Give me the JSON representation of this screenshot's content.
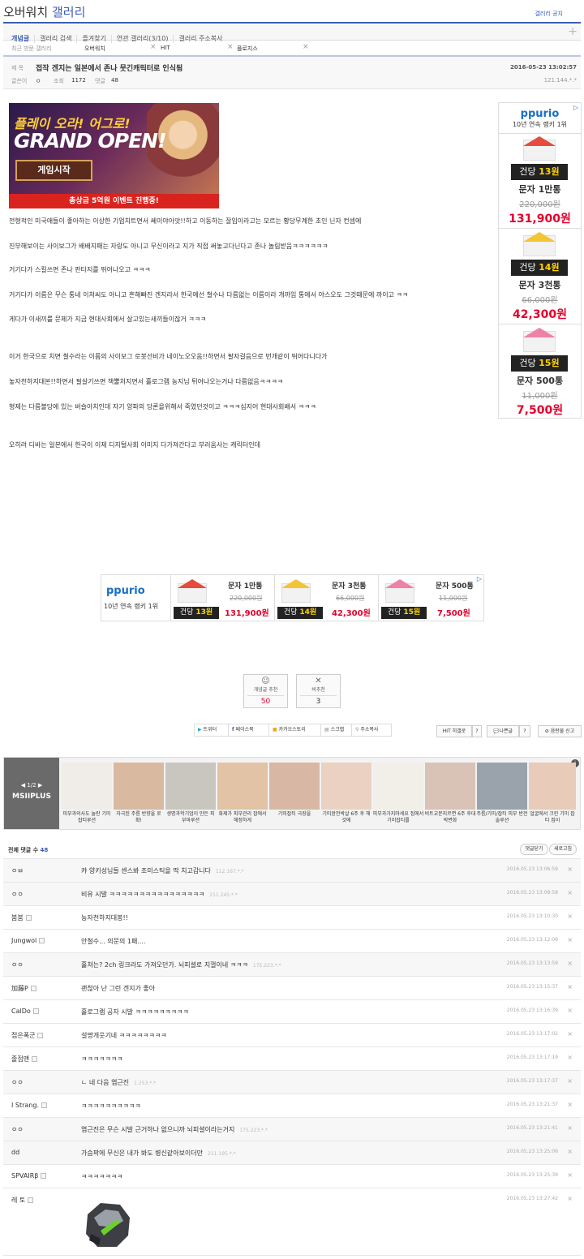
{
  "header": {
    "title_prefix": "오버워치",
    "title_suffix": "갤러리",
    "top_right": "갤러리 공지"
  },
  "tabs": [
    "개념글",
    "갤러리 검색",
    "즐겨찾기",
    "연관 갤러리(3/10)",
    "갤러리 주소복사"
  ],
  "plus": "+",
  "recent": {
    "label": "최근 방문 갤러리",
    "items": [
      "오버워치",
      "HIT",
      "플로지스"
    ]
  },
  "post": {
    "title_label": "제 목",
    "title": "접작 겐지는 일본에서 존나 뭇긴캐릭터로 인식됨",
    "date": "2016-05-23 13:02:57",
    "author_label": "글쓴이",
    "author": "ㅇ",
    "views_label": "조회",
    "views": "1172",
    "comments_label": "댓글",
    "comments": "48",
    "ip": "121.144.*.*",
    "body": [
      "전형적인 미국애들이 좋아하는 이상한 기업치트면서 쎄이야아앗!!하고 이동하는 잘입이라고는 모르는 황당무계한 초인 닌자 컨셉에",
      "진부해보이는 사이보그가 배배지패는 자랑도 아니고 무신이라고 지가 직접 써놓고다닌다고 존나 놀림받음ㅋㅋㅋㅋㅋㅋ",
      "거기다가 스킬쓰면 존나 판타지를 뛰어나오고 ㅋㅋㅋ",
      "거기다가 이름은 무슨 통네 이쳐씨도 아니고 흔해빠진 겐지라서 한국에선 철수나 다름없는 이름이라 개까임 통에서 야스오도 그것때문에 까이고 ㅋㅋ",
      "게다가 이새끼를 문제가 지금 현대사회에서 살고있는새끼들이잖거 ㅋㅋㅋ",
      "이거 한국으로 치면 철수라는 이름의 사이보그 로봇선비가 네이노오오옴!!하면서 팔자걸음으로 번개같이 뛰어다니다가",
      "놓자천하지대본!!하면서 필살기쓰면 책뿔처지면서 홀로그램 농지님 튀어나오는거나 다름없음ㅋㅋㅋㅋ",
      "형제는 다름볼당에 있는 버슬아치인데 자기 양파의 당론을위해서 죽였던것이고 ㅋㅋㅋ심지어 현대사회배서 ㅋㅋㅋ",
      "오히려 디바는 일본에서 한국이 이제 디지털사회 이미지 다가져간다고 부러움사는 캐릭터인데"
    ]
  },
  "game_ad": {
    "line1": "플레이 오라! 어그로!",
    "line2": "GRAND OPEN!",
    "button": "게임시작",
    "bottom": "총상금 5억원 이벤트 진행중!"
  },
  "ppurio": {
    "brand": "ppurio",
    "tagline": "10년 연속 랭키 1위",
    "items": [
      {
        "price_prefix": "건당",
        "price": "13원",
        "name": "문자 1만통",
        "old": "220,000원",
        "new": "131,900원",
        "color": "#e44c3d"
      },
      {
        "price_prefix": "건당",
        "price": "14원",
        "name": "문자 3천통",
        "old": "66,000원",
        "new": "42,300원",
        "color": "#f3c533"
      },
      {
        "price_prefix": "건당",
        "price": "15원",
        "name": "문자 500통",
        "old": "11,000원",
        "new": "7,500원",
        "color": "#ee82a5"
      }
    ]
  },
  "votes": {
    "up_label": "개념글 추천",
    "up": "50",
    "down_label": "비추천",
    "down": "3"
  },
  "share": [
    "트위터",
    "페이스북",
    "카카오스토리",
    "스크랩",
    "주소복사"
  ],
  "actions": [
    "HIT 히갤로",
    "?",
    "나쁜글",
    "?",
    "음란물 신고"
  ],
  "ad_strip": {
    "pager": "1/2",
    "brand": "MSIIPLUS",
    "captions": [
      "피부과의사도 놀란 기미잡티루션",
      "자극된 주름 반향을 로 확!",
      "생명과학기업이 만든 피부마루션",
      "화제가 피부관리 잡에서 해정하게",
      "기미잡티 극장을",
      "기미완전박살 6주 후 해것에",
      "피부과가지마세요 집에서기미잡티를",
      "비트교문지르면 6주 후대박변화",
      "주름/기미/잡티 피부 반전솔루션",
      "얼굴에서 크린 기미 잡티 집이"
    ]
  },
  "comments_header": {
    "label": "전체 댓글 수",
    "count": "48",
    "fold": "댓글닫기",
    "refresh": "새로고침"
  },
  "comments": [
    {
      "nick": "ㅇㅂ",
      "text": "캬 양키성님들 센스봐 조미스틱을 딱 치고갑니다",
      "ip": "112.167.*.*",
      "date": "2016.05.23 13:06:59",
      "icon": false
    },
    {
      "nick": "ㅇㅇ",
      "text": "비유 시발 ㅋㅋㅋㅋㅋㅋㅋㅋㅋㅋㅋㅋㅋㅋㅋㅋ",
      "ip": "211.245.*.*",
      "date": "2016.05.23 13:08:58",
      "icon": false
    },
    {
      "nick": "붐붐",
      "text": "농자천하지대봉!!",
      "ip": "",
      "date": "2016.05.23 13:10:30",
      "icon": true
    },
    {
      "nick": "Jungwol",
      "text": "안철수... 의문의 1패....",
      "ip": "",
      "date": "2016.05.23 13:12:06",
      "icon": true
    },
    {
      "nick": "ㅇㅇ",
      "text": "홀쳐는? 2ch 링크라도 가져오던가. 뇌피셜로 지껄이네 ㅋㅋㅋ",
      "ip": "175.223.*.*",
      "date": "2016.05.23 13:13:59",
      "icon": false
    },
    {
      "nick": "加藤P",
      "text": "괜찮아 난 그런 겐지가 좋아",
      "ip": "",
      "date": "2016.05.23 13:15:37",
      "icon": true
    },
    {
      "nick": "CalDo",
      "text": "홀로그램 공자 시발 ㅋㅋㅋㅋㅋㅋㅋㅋㅋ",
      "ip": "",
      "date": "2016.05.23 13:16:39",
      "icon": true
    },
    {
      "nick": "접은폭군",
      "text": "설명개웃기네 ㅋㅋㅋㅋㅋㅋㅋㅋ",
      "ip": "",
      "date": "2016.05.23 13:17:02",
      "icon": true
    },
    {
      "nick": "졸접맨",
      "text": "ㅋㅋㅋㅋㅋㅋㅋ",
      "ip": "",
      "date": "2016.05.23 13:17:19",
      "icon": true
    },
    {
      "nick": "ㅇㅇ",
      "text": "ㄴ 네 다음 엽근진",
      "ip": "1.253.*.*",
      "date": "2016.05.23 13:17:37",
      "icon": false
    },
    {
      "nick": "I Strang.",
      "text": "ㅋㅋㅋㅋㅋㅋㅋㅋㅋㅋ",
      "ip": "",
      "date": "2016.05.23 13:21:37",
      "icon": true
    },
    {
      "nick": "ㅇㅇ",
      "text": "엽근진은 무슨 시발 근거하나 없으니까 뇌피셜이라는거지",
      "ip": "175.223.*.*",
      "date": "2016.05.23 13:21:41",
      "icon": false
    },
    {
      "nick": "dd",
      "text": "가슴팍에 무신은 내가 봐도 병신같아보이더만",
      "ip": "211.195.*.*",
      "date": "2016.05.23 13:25:06",
      "icon": false
    },
    {
      "nick": "SPVAIRβ",
      "text": "ㅋㅋㅋㅋㅋㅋㅋ",
      "ip": "",
      "date": "2016.05.23 13:25:39",
      "icon": true
    },
    {
      "nick": "레 토",
      "text": "",
      "ip": "",
      "date": "2016.05.23 13:27:42",
      "icon": true
    }
  ]
}
